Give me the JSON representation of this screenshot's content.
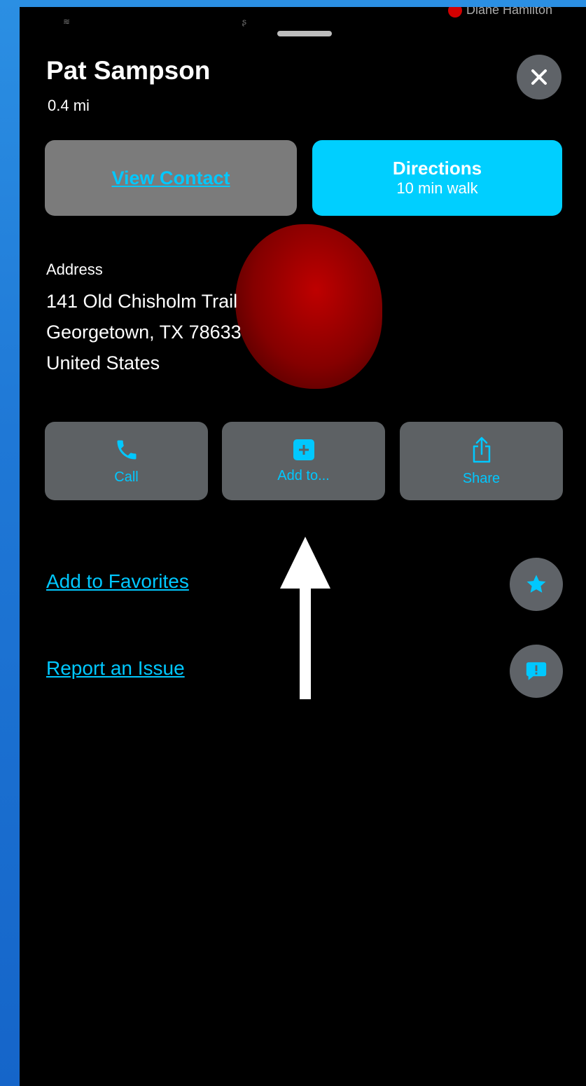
{
  "top": {
    "left_glyphs": [
      "≋",
      "ʂ"
    ],
    "right_label": "Diane Hamilton"
  },
  "place": {
    "name": "Pat Sampson",
    "distance": "0.4 mi"
  },
  "buttons": {
    "view_contact": "View Contact",
    "directions_title": "Directions",
    "directions_sub": "10 min walk"
  },
  "address": {
    "heading": "Address",
    "lines": [
      "141 Old Chisholm Trail",
      "Georgetown, TX  78633",
      "United States"
    ]
  },
  "actions": [
    {
      "label": "Call",
      "icon": "phone-icon"
    },
    {
      "label": "Add to...",
      "icon": "plus-square-icon"
    },
    {
      "label": "Share",
      "icon": "share-icon"
    }
  ],
  "links": {
    "favorites": "Add to Favorites",
    "report": "Report an Issue"
  },
  "icons": {
    "favorites": "star-icon",
    "report": "report-bubble-icon",
    "close": "close-icon"
  },
  "colors": {
    "accent": "#00c8ff",
    "background": "#000000",
    "page_bg": "#1f78d6",
    "button_gray": "#7b7b7b",
    "icon_circle": "#5f6368",
    "highlight_red": "#c80000"
  }
}
